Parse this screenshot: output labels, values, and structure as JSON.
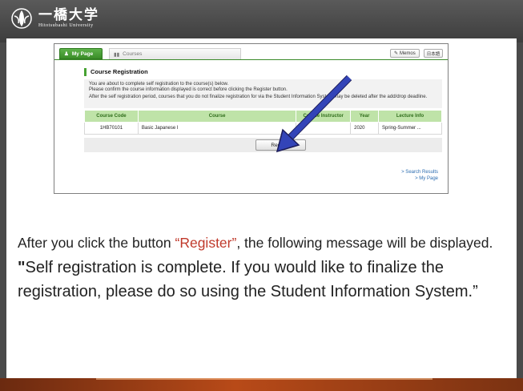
{
  "slide": {
    "logo": {
      "jp": "一橋大学",
      "en": "Hitotsubashi University"
    },
    "caption": {
      "before": "After you click the button ",
      "highlight": "“Register”",
      "after": ", the following message will be displayed.",
      "open_quote": "\"",
      "message": "Self registration is complete. If you would like to finalize the registration, please do so using the Student Information System.”"
    }
  },
  "app": {
    "tabs": [
      {
        "label": "My Page",
        "icon": "person-icon",
        "active": true
      },
      {
        "label": "Courses",
        "icon": "chart-icon",
        "active": false
      }
    ],
    "memos_label": "Memos",
    "language_label": "日本語",
    "panel_title": "Course Registration",
    "info": [
      "You are about to complete self registration to the course(s) below.",
      "Please confirm the course information displayed is correct before clicking the Register button.",
      "After the self registration period, courses that you do not finalize registration for via the Student Information System may be deleted after the add/drop deadline."
    ],
    "table": {
      "headers": [
        "Course Code",
        "Course",
        "Course Instructor",
        "Year",
        "Lecture Info"
      ],
      "rows": [
        [
          "1HB70101",
          "Basic Japanese I",
          "",
          "2020",
          "Spring-Summer ..."
        ]
      ]
    },
    "register_label": "Register",
    "links": [
      "> Search Results",
      "> My Page"
    ]
  },
  "colors": {
    "accent_green": "#47a232",
    "header_green": "#bfe3a8",
    "arrow_blue": "#2f3fb0",
    "highlight_red": "#c0392b"
  }
}
